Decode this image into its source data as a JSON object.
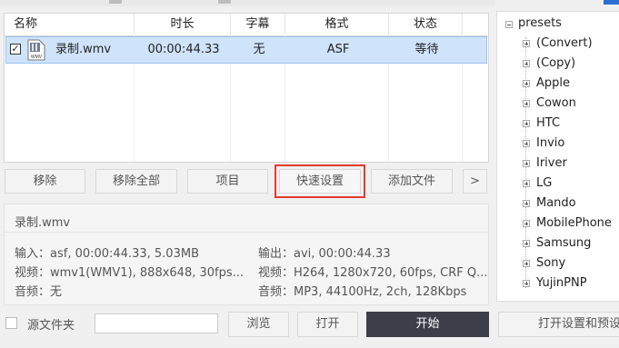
{
  "table": {
    "headers": {
      "name": "名称",
      "duration": "时长",
      "subtitle": "字幕",
      "format": "格式",
      "status": "状态"
    },
    "rows": [
      {
        "checked": true,
        "icon": "wmv-file-icon",
        "file_icon_label": "WMV",
        "name": "录制.wmv",
        "duration": "00:00:44.33",
        "subtitle": "无",
        "format": "ASF",
        "status": "等待"
      }
    ]
  },
  "buttons": {
    "remove": "移除",
    "remove_all": "移除全部",
    "item": "项目",
    "quick_settings": "快速设置",
    "add_file": "添加文件",
    "more": ">"
  },
  "info": {
    "filename": "录制.wmv",
    "input": "输入：asf, 00:00:44.33, 5.03MB",
    "output": "输出：avi, 00:00:44.33",
    "video_in": "视频：wmv1(WMV1), 888x648, 30fps...",
    "video_out": "视频：H264, 1280x720, 60fps, CRF Q...",
    "audio_in": "音频：无",
    "audio_out": "音频：MP3, 44100Hz, 2ch, 128Kbps"
  },
  "tree": {
    "root": "presets",
    "items": [
      "(Convert)",
      "(Copy)",
      "Apple",
      "Cowon",
      "HTC",
      "Invio",
      "Iriver",
      "LG",
      "Mando",
      "MobilePhone",
      "Samsung",
      "Sony",
      "YujinPNP"
    ]
  },
  "bottom": {
    "source_folder_label": "源文件夹",
    "source_folder_value": "",
    "browse": "浏览",
    "open": "打开",
    "start": "开始",
    "open_settings": "打开设置和预设"
  },
  "colors": {
    "selected_row": "#cfe3fb",
    "highlight_outline": "#e43a2f",
    "start_button": "#3c3f4a"
  }
}
